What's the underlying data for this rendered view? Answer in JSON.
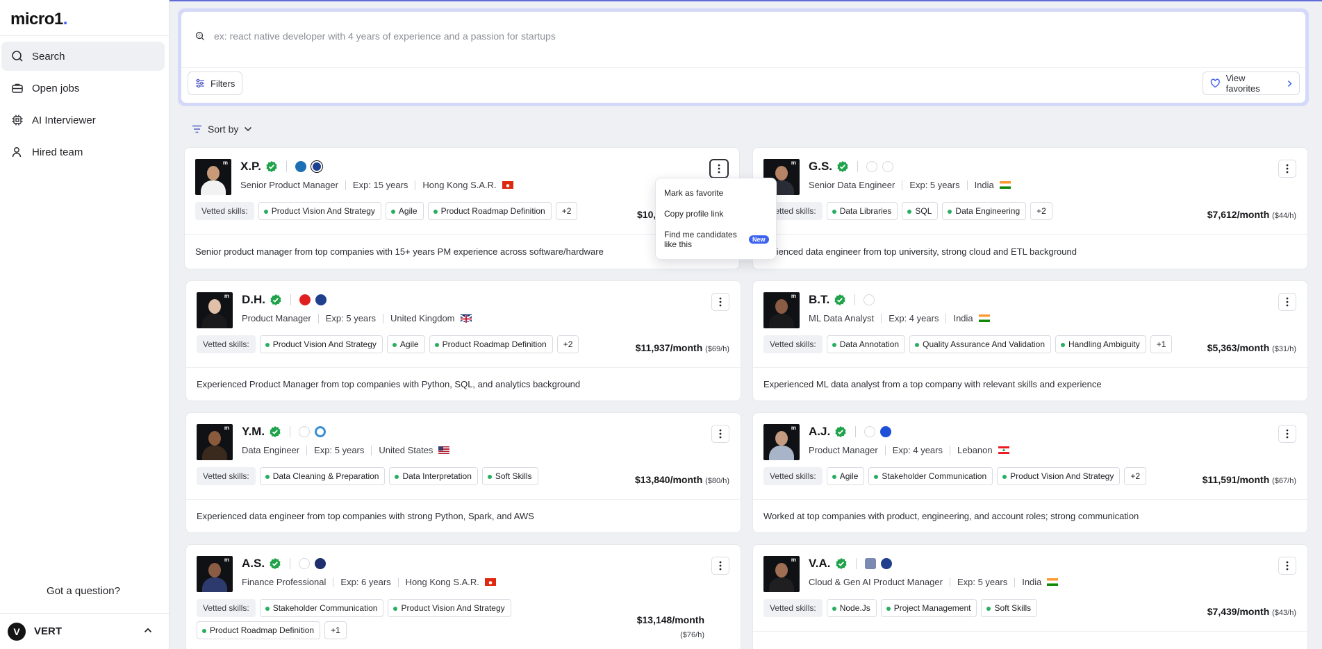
{
  "app": {
    "logo": "micro1",
    "logo_dot": "."
  },
  "sidebar": {
    "items": [
      {
        "label": "Search",
        "icon": "search-icon"
      },
      {
        "label": "Open jobs",
        "icon": "briefcase-icon"
      },
      {
        "label": "AI Interviewer",
        "icon": "chip-icon"
      },
      {
        "label": "Hired team",
        "icon": "people-icon"
      }
    ],
    "question": "Got a question?",
    "user": {
      "initial": "V",
      "name": "VERT"
    }
  },
  "search": {
    "placeholder": "ex: react native developer with 4 years of experience and a passion for startups",
    "filters_label": "Filters",
    "favorites_label": "View favorites"
  },
  "sort": {
    "label": "Sort by"
  },
  "vetted_label": "Vetted skills:",
  "menu": {
    "favorite": "Mark as favorite",
    "copy": "Copy profile link",
    "similar_line1": "Find me candidates",
    "similar_line2": "like this",
    "new_badge": "New"
  },
  "candidates": [
    {
      "name": "X.P.",
      "role": "Senior Product Manager",
      "exp": "Exp: 15 years",
      "location": "Hong Kong S.A.R.",
      "skills": [
        "Product Vision And Strategy",
        "Agile",
        "Product Roadmap Definition"
      ],
      "more": "+2",
      "price": "$10,",
      "rate": "",
      "desc": "Senior product manager from top companies with 15+ years PM experience across software/hardware"
    },
    {
      "name": "G.S.",
      "role": "Senior Data Engineer",
      "exp": "Exp: 5 years",
      "location": "India",
      "skills": [
        "Data Libraries",
        "SQL",
        "Data Engineering"
      ],
      "more": "+2",
      "price": "$7,612/month",
      "rate": "($44/h)",
      "desc": "perienced data engineer from top university, strong cloud and ETL background"
    },
    {
      "name": "D.H.",
      "role": "Product Manager",
      "exp": "Exp: 5 years",
      "location": "United Kingdom",
      "skills": [
        "Product Vision And Strategy",
        "Agile",
        "Product Roadmap Definition"
      ],
      "more": "+2",
      "price": "$11,937/month",
      "rate": "($69/h)",
      "desc": "Experienced Product Manager from top companies with Python, SQL, and analytics background"
    },
    {
      "name": "B.T.",
      "role": "ML Data Analyst",
      "exp": "Exp: 4 years",
      "location": "India",
      "skills": [
        "Data Annotation",
        "Quality Assurance And Validation",
        "Handling Ambiguity"
      ],
      "more": "+1",
      "price": "$5,363/month",
      "rate": "($31/h)",
      "desc": "Experienced ML data analyst from a top company with relevant skills and experience"
    },
    {
      "name": "Y.M.",
      "role": "Data Engineer",
      "exp": "Exp: 5 years",
      "location": "United States",
      "skills": [
        "Data Cleaning & Preparation",
        "Data Interpretation",
        "Soft Skills"
      ],
      "more": "",
      "price": "$13,840/month",
      "rate": "($80/h)",
      "desc": "Experienced data engineer from top companies with strong Python, Spark, and AWS"
    },
    {
      "name": "A.J.",
      "role": "Product Manager",
      "exp": "Exp: 4 years",
      "location": "Lebanon",
      "skills": [
        "Agile",
        "Stakeholder Communication",
        "Product Vision And Strategy"
      ],
      "more": "+2",
      "price": "$11,591/month",
      "rate": "($67/h)",
      "desc": "Worked at top companies with product, engineering, and account roles; strong communication"
    },
    {
      "name": "A.S.",
      "role": "Finance Professional",
      "exp": "Exp: 6 years",
      "location": "Hong Kong S.A.R.",
      "skills": [
        "Stakeholder Communication",
        "Product Vision And Strategy",
        "Product Roadmap Definition"
      ],
      "more": "+1",
      "price": "$13,148/month",
      "rate": "($76/h)",
      "desc": ""
    },
    {
      "name": "V.A.",
      "role": "Cloud & Gen AI Product Manager",
      "exp": "Exp: 5 years",
      "location": "India",
      "skills": [
        "Node.Js",
        "Project Management",
        "Soft Skills"
      ],
      "more": "",
      "price": "$7,439/month",
      "rate": "($43/h)",
      "desc": ""
    }
  ],
  "colors": {
    "accent": "#3e63f0",
    "verified": "#1fa24a",
    "skill_dot": "#27ae60",
    "search_border": "#d4d9f9"
  }
}
